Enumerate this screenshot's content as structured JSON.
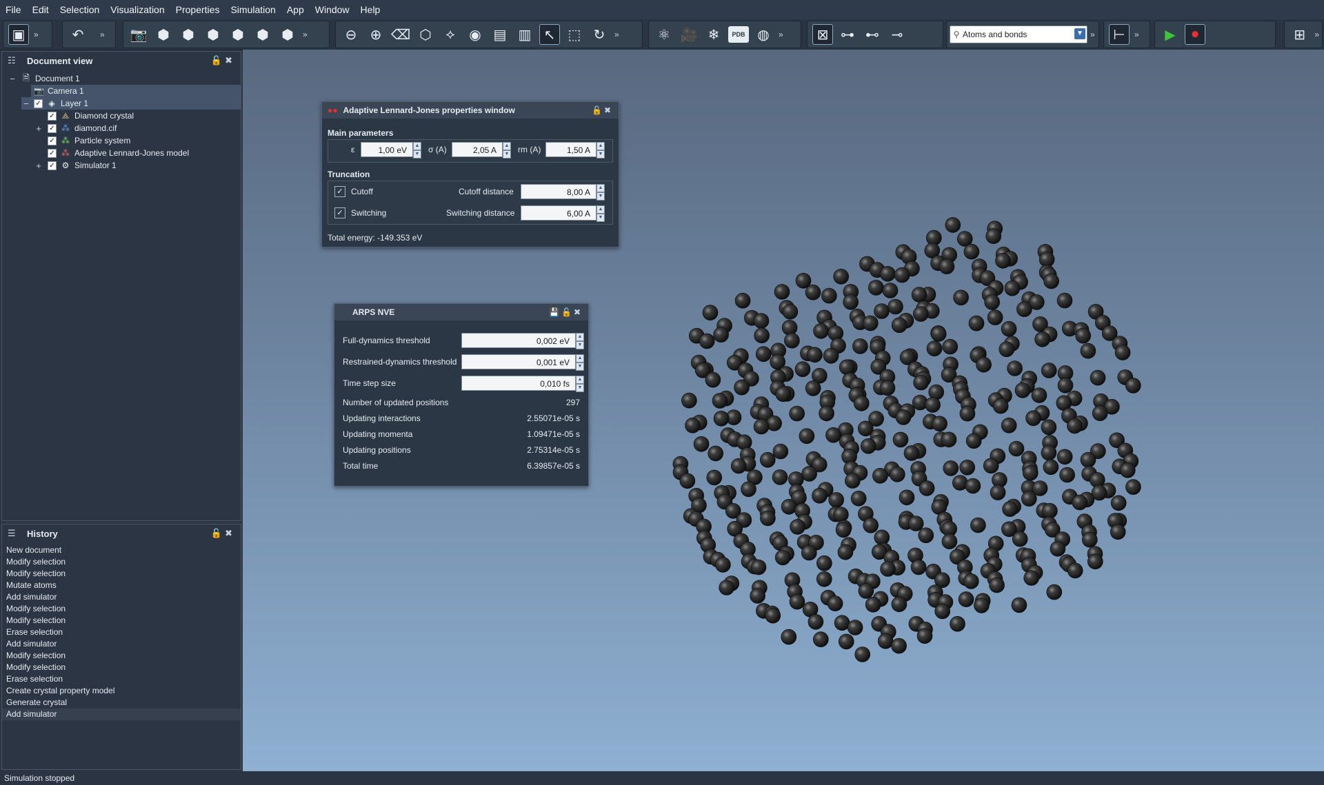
{
  "menu": [
    "File",
    "Edit",
    "Selection",
    "Visualization",
    "Properties",
    "Simulation",
    "App",
    "Window",
    "Help"
  ],
  "toolbar": {
    "render_mode": "Atoms and bonds",
    "pdb_label": "PDB",
    "more": "»"
  },
  "document_view": {
    "title": "Document view",
    "items": [
      {
        "label": "Document 1",
        "toggle": "−",
        "checkbox": false,
        "icon": "document-icon",
        "level": 0
      },
      {
        "label": "Camera 1",
        "toggle": "",
        "checkbox": false,
        "icon": "camera-icon",
        "level": 1
      },
      {
        "label": "Layer 1",
        "toggle": "−",
        "checkbox": true,
        "icon": "layer-icon",
        "level": 1
      },
      {
        "label": "Diamond crystal",
        "toggle": "",
        "checkbox": true,
        "icon": "crystal-icon",
        "level": 2
      },
      {
        "label": "diamond.cif",
        "toggle": "+",
        "checkbox": true,
        "icon": "cif-icon",
        "level": 2
      },
      {
        "label": "Particle system",
        "toggle": "",
        "checkbox": true,
        "icon": "particle-system-icon",
        "level": 2
      },
      {
        "label": "Adaptive Lennard-Jones model",
        "toggle": "",
        "checkbox": true,
        "icon": "lj-model-icon",
        "level": 2
      },
      {
        "label": "Simulator 1",
        "toggle": "+",
        "checkbox": true,
        "icon": "simulator-icon",
        "level": 2
      }
    ]
  },
  "history": {
    "title": "History",
    "items": [
      "New document",
      "Modify selection",
      "Modify selection",
      "Mutate atoms",
      "Add simulator",
      "Modify selection",
      "Modify selection",
      "Erase selection",
      "Add simulator",
      "Modify selection",
      "Modify selection",
      "Erase selection",
      "Create crystal property model",
      "Generate crystal",
      "Add simulator"
    ]
  },
  "lj_window": {
    "title": "Adaptive Lennard-Jones properties window",
    "main_params_label": "Main parameters",
    "epsilon_label": "ε",
    "epsilon_value": "1,00 eV",
    "sigma_label": "σ (A)",
    "sigma_value": "2,05 A",
    "rm_label": "rm (A)",
    "rm_value": "1,50 A",
    "truncation_label": "Truncation",
    "cutoff_label": "Cutoff",
    "cutoff_distance_label": "Cutoff distance",
    "cutoff_distance_value": "8,00 A",
    "switching_label": "Switching",
    "switching_distance_label": "Switching distance",
    "switching_distance_value": "6,00 A",
    "total_energy": "Total energy: -149.353 eV"
  },
  "arps_window": {
    "title": "ARPS NVE",
    "full_dynamics_label": "Full-dynamics threshold",
    "full_dynamics_value": "0,002 eV",
    "restrained_label": "Restrained-dynamics threshold",
    "restrained_value": "0,001 eV",
    "timestep_label": "Time step size",
    "timestep_value": "0,010 fs",
    "stats": [
      {
        "label": "Number of updated positions",
        "value": "297"
      },
      {
        "label": "Updating interactions",
        "value": "2.55071e-05 s"
      },
      {
        "label": "Updating momenta",
        "value": "1.09471e-05 s"
      },
      {
        "label": "Updating positions",
        "value": "2.75314e-05 s"
      },
      {
        "label": "Total time",
        "value": "6.39857e-05 s"
      }
    ]
  },
  "status": "Simulation stopped"
}
